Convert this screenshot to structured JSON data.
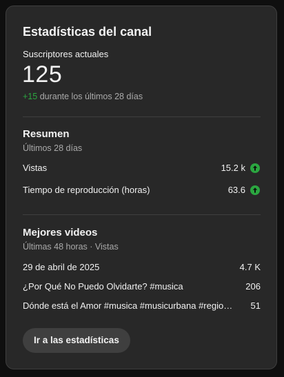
{
  "card": {
    "title": "Estadísticas del canal",
    "subscribers": {
      "label": "Suscriptores actuales",
      "count": "125",
      "delta": "+15",
      "period_text": " durante los últimos 28 días"
    }
  },
  "summary": {
    "title": "Resumen",
    "subtitle": "Últimos 28 días",
    "metrics": [
      {
        "label": "Vistas",
        "value": "15.2 k",
        "trend": "up"
      },
      {
        "label": "Tiempo de reproducción (horas)",
        "value": "63.6",
        "trend": "up"
      }
    ]
  },
  "top_videos": {
    "title": "Mejores videos",
    "subtitle": "Últimas 48 horas · Vistas",
    "items": [
      {
        "title": "29 de abril de 2025",
        "views": "4.7 K"
      },
      {
        "title": "¿Por Qué No Puedo Olvidarte? #musica",
        "views": "206"
      },
      {
        "title": "Dónde está el Amor #musica #musicurbana #regional #musicaromantica",
        "views": "51"
      }
    ]
  },
  "cta": {
    "label": "Ir a las estadísticas"
  },
  "colors": {
    "card_bg": "#282828",
    "positive": "#2ba640",
    "muted_text": "#aaaaaa"
  },
  "icons": {
    "trend_up": "arrow-up-circle-icon"
  }
}
